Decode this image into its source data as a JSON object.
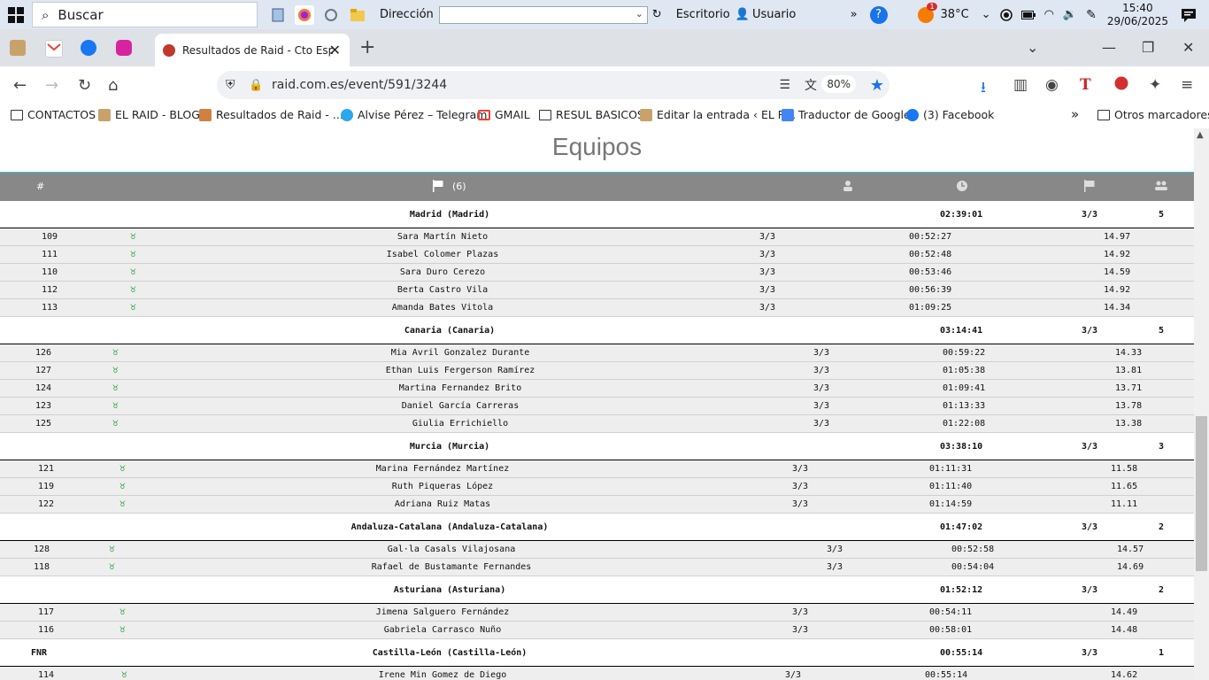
{
  "taskbar": {
    "search_placeholder": "Buscar",
    "address_label": "Dirección",
    "desktop_label": "Escritorio",
    "user_label": "Usuario",
    "weather_badge": "1",
    "temperature": "38°C",
    "time": "15:40",
    "date": "29/06/2025"
  },
  "browser": {
    "tab_title": "Resultados de Raid - Cto España",
    "url": "raid.com.es/event/591/3244",
    "zoom": "80%",
    "bookmarks": [
      {
        "label": "CONTACTOS",
        "icon": "folder-icon"
      },
      {
        "label": "EL RAID - BLOG",
        "icon": "blog-icon"
      },
      {
        "label": "Resultados de Raid - ...",
        "icon": "raid-icon"
      },
      {
        "label": "Alvise Pérez – Telegram",
        "icon": "telegram-icon"
      },
      {
        "label": "GMAIL",
        "icon": "gmail-icon"
      },
      {
        "label": "RESUL BASICOS",
        "icon": "folder-icon"
      },
      {
        "label": "Editar la entrada ‹ EL R...",
        "icon": "blog-icon"
      },
      {
        "label": "Traductor de Google",
        "icon": "translate-icon"
      },
      {
        "label": "(3) Facebook",
        "icon": "facebook-icon"
      }
    ],
    "other_bookmarks": "Otros marcadores"
  },
  "page": {
    "section_title": "Equipos",
    "header": {
      "rank": "#",
      "flag_count": "(6)"
    },
    "teams": [
      {
        "rank": "",
        "name": "Madrid (Madrid)",
        "time": "02:39:01",
        "stages": "3/3",
        "members_count": "5",
        "members": [
          {
            "bib": "109",
            "name": "Sara Martín Nieto",
            "stages": "3/3",
            "time": "00:52:27",
            "speed": "14.97"
          },
          {
            "bib": "111",
            "name": "Isabel Colomer Plazas",
            "stages": "3/3",
            "time": "00:52:48",
            "speed": "14.92"
          },
          {
            "bib": "110",
            "name": "Sara Duro Cerezo",
            "stages": "3/3",
            "time": "00:53:46",
            "speed": "14.59"
          },
          {
            "bib": "112",
            "name": "Berta Castro Vila",
            "stages": "3/3",
            "time": "00:56:39",
            "speed": "14.92"
          },
          {
            "bib": "113",
            "name": "Amanda Bates Vitola",
            "stages": "3/3",
            "time": "01:09:25",
            "speed": "14.34"
          }
        ]
      },
      {
        "rank": "",
        "name": "Canaria (Canaria)",
        "time": "03:14:41",
        "stages": "3/3",
        "members_count": "5",
        "members": [
          {
            "bib": "126",
            "name": "Mia Avril Gonzalez Durante",
            "stages": "3/3",
            "time": "00:59:22",
            "speed": "14.33"
          },
          {
            "bib": "127",
            "name": "Ethan Luis Fergerson Ramírez",
            "stages": "3/3",
            "time": "01:05:38",
            "speed": "13.81"
          },
          {
            "bib": "124",
            "name": "Martina Fernandez Brito",
            "stages": "3/3",
            "time": "01:09:41",
            "speed": "13.71"
          },
          {
            "bib": "123",
            "name": "Daniel García Carreras",
            "stages": "3/3",
            "time": "01:13:33",
            "speed": "13.78"
          },
          {
            "bib": "125",
            "name": "Giulia Errichiello",
            "stages": "3/3",
            "time": "01:22:08",
            "speed": "13.38"
          }
        ]
      },
      {
        "rank": "",
        "name": "Murcia (Murcia)",
        "time": "03:38:10",
        "stages": "3/3",
        "members_count": "3",
        "members": [
          {
            "bib": "121",
            "name": "Marina Fernández Martínez",
            "stages": "3/3",
            "time": "01:11:31",
            "speed": "11.58"
          },
          {
            "bib": "119",
            "name": "Ruth Piqueras López",
            "stages": "3/3",
            "time": "01:11:40",
            "speed": "11.65"
          },
          {
            "bib": "122",
            "name": "Adriana Ruiz Matas",
            "stages": "3/3",
            "time": "01:14:59",
            "speed": "11.11"
          }
        ]
      },
      {
        "rank": "",
        "name": "Andaluza-Catalana (Andaluza-Catalana)",
        "time": "01:47:02",
        "stages": "3/3",
        "members_count": "2",
        "members": [
          {
            "bib": "128",
            "name": "Gal·la Casals Vilajosana",
            "stages": "3/3",
            "time": "00:52:58",
            "speed": "14.57"
          },
          {
            "bib": "118",
            "name": "Rafael de Bustamante Fernandes",
            "stages": "3/3",
            "time": "00:54:04",
            "speed": "14.69"
          }
        ]
      },
      {
        "rank": "",
        "name": "Asturiana (Asturiana)",
        "time": "01:52:12",
        "stages": "3/3",
        "members_count": "2",
        "members": [
          {
            "bib": "117",
            "name": "Jimena Salguero Fernández",
            "stages": "3/3",
            "time": "00:54:11",
            "speed": "14.49"
          },
          {
            "bib": "116",
            "name": "Gabriela Carrasco Nuño",
            "stages": "3/3",
            "time": "00:58:01",
            "speed": "14.48"
          }
        ]
      },
      {
        "rank": "FNR",
        "name": "Castilla-León (Castilla-León)",
        "time": "00:55:14",
        "stages": "3/3",
        "members_count": "1",
        "members": [
          {
            "bib": "114",
            "name": "Irene Min Gomez de Diego",
            "stages": "3/3",
            "time": "00:55:14",
            "speed": "14.62"
          }
        ]
      }
    ]
  }
}
